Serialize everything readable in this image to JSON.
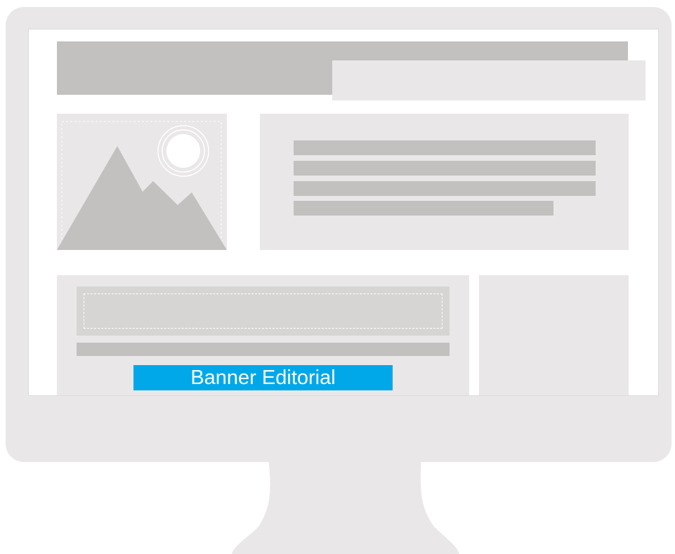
{
  "banner": {
    "label": "Banner Editorial"
  },
  "colors": {
    "monitor": "#e9e7e8",
    "screen": "#ffffff",
    "placeholder_dark": "#c2c1bf",
    "placeholder_light": "#e9e7e8",
    "banner": "#00a8ea",
    "banner_text": "#ffffff"
  },
  "icons": {
    "image_placeholder": "mountain-sun-icon"
  }
}
